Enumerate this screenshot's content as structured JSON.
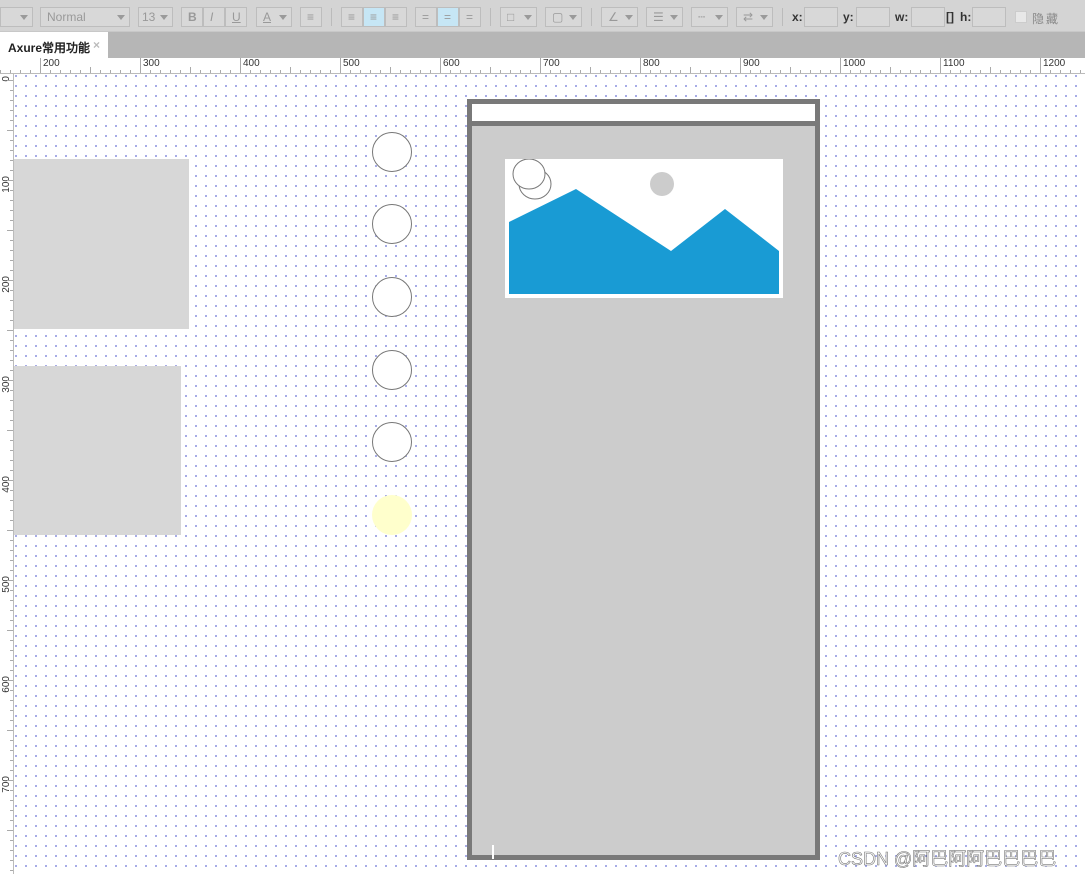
{
  "toolbar": {
    "font_style": "Normal",
    "font_size": "13",
    "bold": "B",
    "italic": "I",
    "underline": "U",
    "font_color": "A",
    "x_label": "x:",
    "y_label": "y:",
    "w_label": "w:",
    "h_label": "h:",
    "x_value": "",
    "y_value": "",
    "w_value": "",
    "h_value": "",
    "hide_label": "隐藏",
    "hide_checked": false
  },
  "tabs": [
    {
      "label": "Axure常用功能",
      "close": "×",
      "active": true
    }
  ],
  "ruler": {
    "horizontal": [
      "200",
      "300",
      "400",
      "500",
      "600",
      "700",
      "800",
      "900",
      "1000",
      "1100",
      "1200"
    ],
    "vertical": [
      "0",
      "100",
      "200",
      "300",
      "400",
      "500",
      "600",
      "700"
    ]
  },
  "canvas": {
    "rect_color": "#d7d7d7",
    "highlight_circle_color": "#ffffcc",
    "phone_frame": {
      "border_color": "#797979",
      "fill": "#cccccc"
    },
    "image_placeholder": {
      "mountain_color": "#199bd4",
      "sun_color": "#cccccc"
    }
  },
  "watermark": "CSDN @阿巴阿阿巴巴巴巴"
}
